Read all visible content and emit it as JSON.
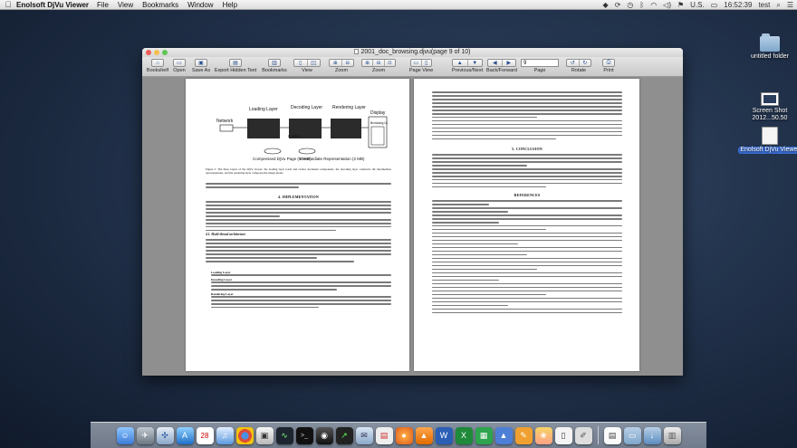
{
  "menubar": {
    "apple": "",
    "app_name": "Enolsoft DjVu Viewer",
    "menus": [
      "File",
      "View",
      "Bookmarks",
      "Window",
      "Help"
    ],
    "input_source": "U.S.",
    "time": "16:52:39",
    "user": "test"
  },
  "desktop": {
    "folder_label": "untitled folder",
    "screenshot_label": "Screen Shot 2012...50.50",
    "app_label": "Enolsoft DjVu Viewer"
  },
  "window": {
    "title": "2001_doc_browsing.djvu(page 9 of 10)",
    "toolbar": {
      "bookshelf": "Bookshelf",
      "open": "Open",
      "save_as": "Save As",
      "export_hidden_text": "Export Hidden Text",
      "bookmarks": "Bookmarks",
      "view": "View",
      "zoom1": "Zoom",
      "zoom2": "Zoom",
      "page_view": "Page View",
      "previous_next": "Previous/Next",
      "back_forward": "Back/Forward",
      "page_value": "9",
      "page": "Page",
      "rotate": "Rotate",
      "print": "Print"
    }
  },
  "document": {
    "left": {
      "diagram": {
        "network": "Network",
        "loading_layer": "Loading Layer",
        "decoding_layer": "Decoding Layer",
        "rendering_layer": "Rendering Layer",
        "display": "Display",
        "browsing_ui": "Browsing UI",
        "cache": "Cache",
        "compressed": "Compressed DjVu Page (50 KB)",
        "intermediate": "Intermediate Representation (2 MB)"
      },
      "figure_caption": "Figure 5. The three layers of the DjVu viewer: the loading layer loads and caches document components, the decoding layer constructs the intermediate representations, and the rendering layer composes the image pixels.",
      "section4": "4. IMPLEMENTATION",
      "subsection41": "4.1. Multi-thread architecture",
      "bullets": [
        "Loading Layer",
        "Decoding Layer",
        "Rendering Layer"
      ]
    },
    "right": {
      "section5": "5. CONCLUSION",
      "references": "REFERENCES"
    }
  },
  "dock": {
    "icons": [
      "finder-icon",
      "launchpad-icon",
      "safari-icon",
      "appstore-icon",
      "calendar-icon",
      "itunes-icon",
      "chrome-icon",
      "preview-icon",
      "activity-icon",
      "terminal-icon",
      "dvd-icon",
      "stocks-icon",
      "mail-icon",
      "pdf-icon",
      "firefox-icon",
      "vlc-icon",
      "word-icon",
      "excel-icon",
      "numbers-icon",
      "keynote-icon",
      "pages-icon",
      "photos-icon",
      "djvu-icon",
      "script-icon",
      "textedit-icon",
      "folder-icon",
      "downloads-icon",
      "trash-icon"
    ]
  }
}
